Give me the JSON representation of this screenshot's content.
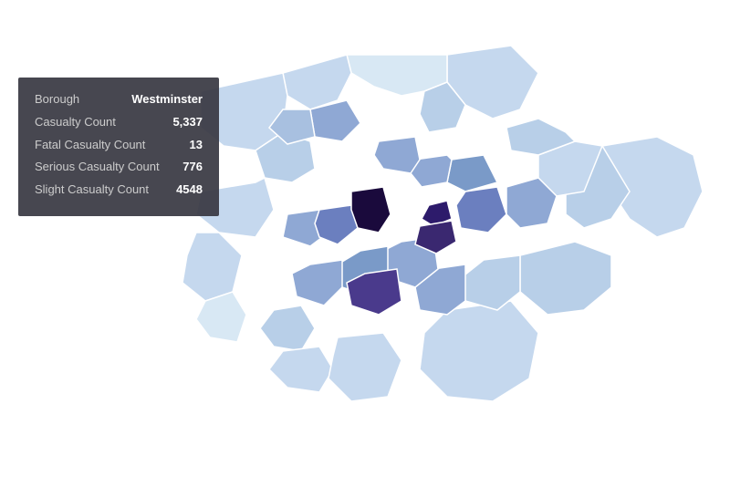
{
  "tooltip": {
    "borough_label": "Borough",
    "borough_value": "Westminster",
    "casualty_label": "Casualty Count",
    "casualty_value": "5,337",
    "fatal_label": "Fatal Casualty Count",
    "fatal_value": "13",
    "serious_label": "Serious Casualty Count",
    "serious_value": "776",
    "slight_label": "Slight Casualty Count",
    "slight_value": "4548"
  },
  "colors": {
    "very_dark": "#1a0a3c",
    "dark": "#2d1b6b",
    "medium_dark": "#4a3a8c",
    "medium": "#6b7fbf",
    "light": "#8fa8d4",
    "lighter": "#a8c0e0",
    "lightest": "#c5d8ee",
    "very_light": "#d8e8f4"
  }
}
